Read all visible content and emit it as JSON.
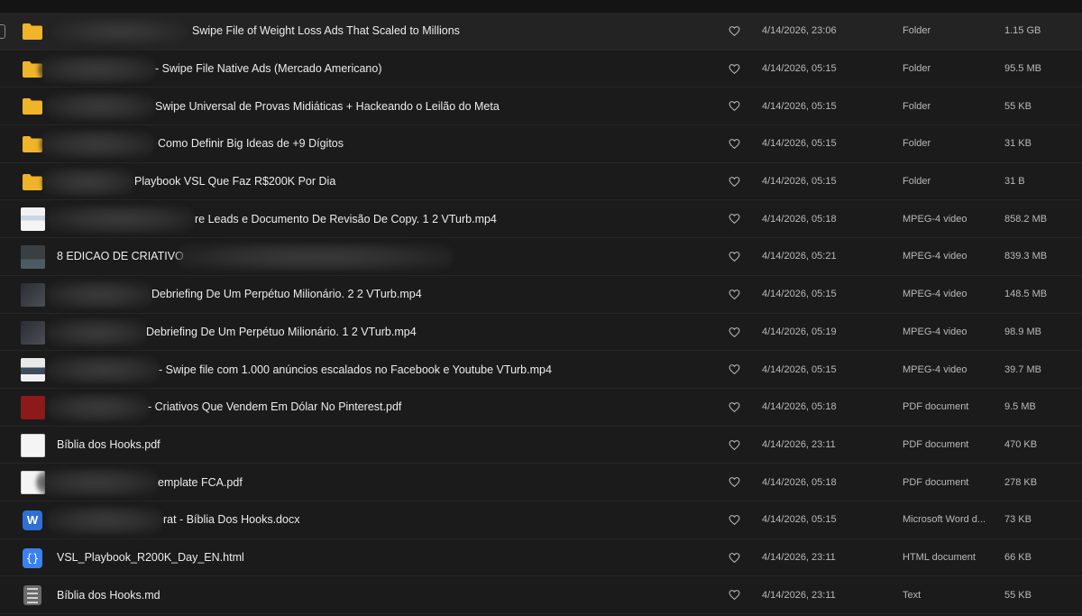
{
  "colors": {
    "folder": "#f0b429",
    "background": "#1b1b1b",
    "selected_row": "#232323"
  },
  "rows": [
    {
      "icon": "folder-icon",
      "name": "Swipe File of Weight Loss Ads That Scaled to Millions",
      "date": "4/14/2026, 23:06",
      "type": "Folder",
      "size": "1.15 GB"
    },
    {
      "icon": "folder-icon",
      "name": "- Swipe File Native Ads (Mercado Americano)",
      "date": "4/14/2026, 05:15",
      "type": "Folder",
      "size": "95.5 MB"
    },
    {
      "icon": "folder-icon",
      "name": "Swipe Universal de Provas Midiáticas + Hackeando o Leilão do Meta",
      "date": "4/14/2026, 05:15",
      "type": "Folder",
      "size": "55 KB"
    },
    {
      "icon": "folder-icon",
      "name": "Como Definir Big Ideas de +9 Dígitos",
      "date": "4/14/2026, 05:15",
      "type": "Folder",
      "size": "31 KB"
    },
    {
      "icon": "folder-icon",
      "name": "Playbook VSL Que Faz R$200K Por Dia",
      "date": "4/14/2026, 05:15",
      "type": "Folder",
      "size": "31 B"
    },
    {
      "icon": "video-thumbnail-icon",
      "name": "re Leads e Documento De Revisão De Copy. 1 2 VTurb.mp4",
      "date": "4/14/2026, 05:18",
      "type": "MPEG-4 video",
      "size": "858.2 MB"
    },
    {
      "icon": "video-thumbnail-icon",
      "name": "8 EDICAO DE CRIATIVO",
      "date": "4/14/2026, 05:21",
      "type": "MPEG-4 video",
      "size": "839.3 MB"
    },
    {
      "icon": "video-thumbnail-icon",
      "name": "Debriefing De Um Perpétuo Milionário. 2 2 VTurb.mp4",
      "date": "4/14/2026, 05:15",
      "type": "MPEG-4 video",
      "size": "148.5 MB"
    },
    {
      "icon": "video-thumbnail-icon",
      "name": "Debriefing De Um Perpétuo Milionário. 1 2 VTurb.mp4",
      "date": "4/14/2026, 05:19",
      "type": "MPEG-4 video",
      "size": "98.9 MB"
    },
    {
      "icon": "video-thumbnail-icon",
      "name": "- Swipe file com 1.000 anúncios escalados no Facebook e Youtube VTurb.mp4",
      "date": "4/14/2026, 05:15",
      "type": "MPEG-4 video",
      "size": "39.7 MB"
    },
    {
      "icon": "pdf-thumbnail-icon",
      "name": "- Criativos Que Vendem Em Dólar No Pinterest.pdf",
      "date": "4/14/2026, 05:18",
      "type": "PDF document",
      "size": "9.5 MB"
    },
    {
      "icon": "pdf-thumbnail-icon",
      "name": "Bíblia dos Hooks.pdf",
      "date": "4/14/2026, 23:11",
      "type": "PDF document",
      "size": "470 KB"
    },
    {
      "icon": "pdf-thumbnail-icon",
      "name": "emplate FCA.pdf",
      "date": "4/14/2026, 05:18",
      "type": "PDF document",
      "size": "278 KB"
    },
    {
      "icon": "word-document-icon",
      "name": "rat - Bíblia Dos Hooks.docx",
      "date": "4/14/2026, 05:15",
      "type": "Microsoft Word d...",
      "size": "73 KB"
    },
    {
      "icon": "html-file-icon",
      "name": "VSL_Playbook_R200K_Day_EN.html",
      "date": "4/14/2026, 23:11",
      "type": "HTML document",
      "size": "66 KB"
    },
    {
      "icon": "text-file-icon",
      "name": "Bíblia dos Hooks.md",
      "date": "4/14/2026, 23:11",
      "type": "Text",
      "size": "55 KB"
    }
  ]
}
